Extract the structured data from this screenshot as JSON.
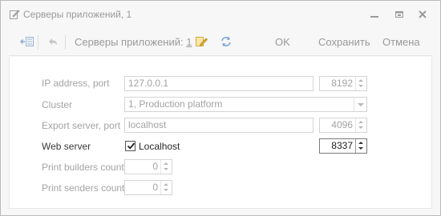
{
  "window": {
    "title": "Серверы приложений, 1"
  },
  "toolbar": {
    "title_prefix": "Серверы приложений:",
    "title_num": "1",
    "ok_label": "OK",
    "save_label": "Сохранить",
    "cancel_label": "Отмена"
  },
  "form": {
    "ip": {
      "label": "IP address, port",
      "value": "127.0.0.1",
      "port": "8192"
    },
    "cluster": {
      "label": "Cluster",
      "value": "1, Production platform"
    },
    "export": {
      "label": "Export server, port",
      "value": "localhost",
      "port": "4096"
    },
    "web": {
      "label": "Web server",
      "checkbox_label": "Localhost",
      "checked": true,
      "port": "8337"
    },
    "builders": {
      "label": "Print builders count",
      "value": "0"
    },
    "senders": {
      "label": "Print senders count",
      "value": "0"
    }
  },
  "icons": {
    "title": "edit-document-icon",
    "back": "back-to-list-icon",
    "undo": "undo-icon",
    "edit": "edit-icon",
    "refresh": "refresh-icon"
  },
  "colors": {
    "accent_edit": "#e3b341",
    "accent_refresh": "#5a8fcf"
  }
}
